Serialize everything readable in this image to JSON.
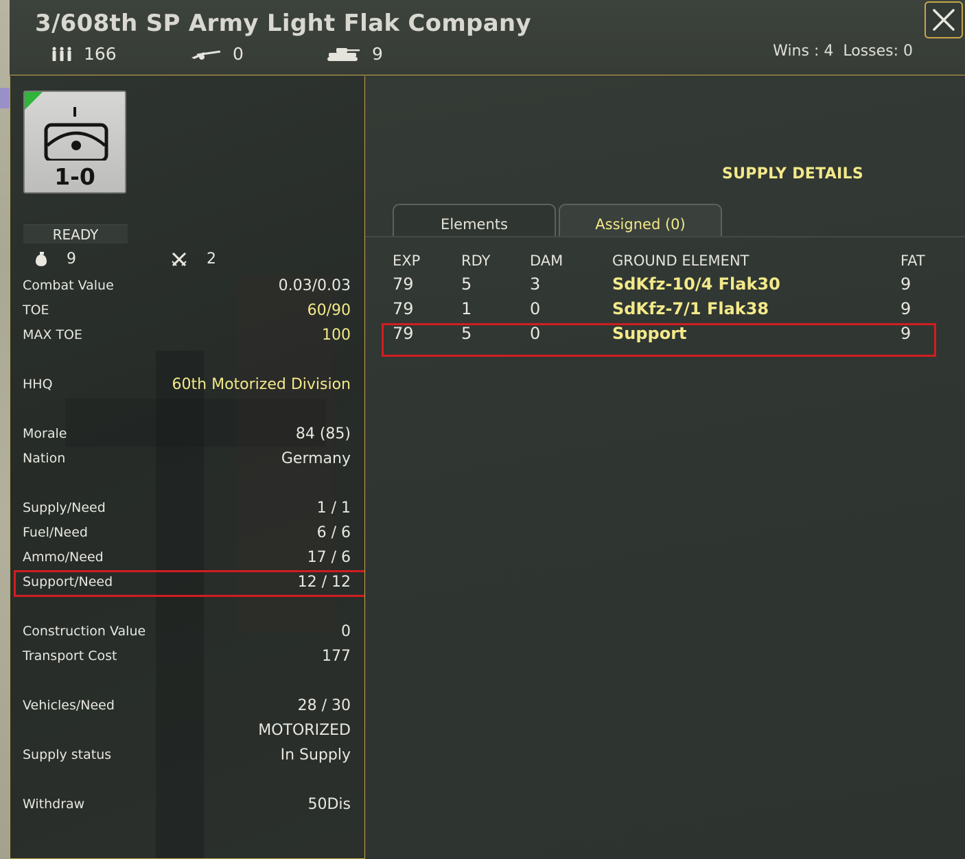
{
  "unit": {
    "title": "3/608th SP Army Light Flak Company",
    "men": "166",
    "guns": "0",
    "afv": "9",
    "record": "Wins : 4  Losses: 0",
    "counter_strength": "1-0",
    "status": "READY"
  },
  "mini_stats": {
    "ammo_count": "9",
    "strength_count": "2"
  },
  "details": [
    {
      "label": "Combat Value",
      "value": "0.03/0.03"
    },
    {
      "label": "TOE",
      "value": "60/90"
    },
    {
      "label": "MAX TOE",
      "value": "100"
    },
    {
      "label": "HHQ",
      "value": "60th Motorized Division"
    },
    {
      "label": "Morale",
      "value": "84 (85)"
    },
    {
      "label": "Nation",
      "value": "Germany"
    },
    {
      "label": "Supply/Need",
      "value": "1 / 1"
    },
    {
      "label": "Fuel/Need",
      "value": "6 / 6"
    },
    {
      "label": "Ammo/Need",
      "value": "17 / 6"
    },
    {
      "label": "Support/Need",
      "value": "12 / 12"
    },
    {
      "label": "Construction Value",
      "value": "0"
    },
    {
      "label": "Transport Cost",
      "value": "177"
    },
    {
      "label": "Vehicles/Need",
      "value": "28 / 30"
    },
    {
      "label": "",
      "value": "MOTORIZED"
    },
    {
      "label": "Supply status",
      "value": "In Supply"
    },
    {
      "label": "Withdraw",
      "value": "50Dis"
    }
  ],
  "supply_panel": {
    "title": "SUPPLY DETAILS",
    "tabs": [
      "Elements",
      "Assigned (0)"
    ],
    "columns": [
      "EXP",
      "RDY",
      "DAM",
      "GROUND ELEMENT",
      "FAT"
    ],
    "rows": [
      [
        "79",
        "5",
        "3",
        "SdKfz-10/4 Flak30",
        "9"
      ],
      [
        "79",
        "1",
        "0",
        "SdKfz-7/1 Flak38",
        "9"
      ],
      [
        "79",
        "5",
        "0",
        "Support",
        "9"
      ]
    ]
  },
  "colors": {
    "accent_yellow": "#f3e98a",
    "border_gold": "#c6a84a",
    "highlight_red": "#d11d22"
  }
}
